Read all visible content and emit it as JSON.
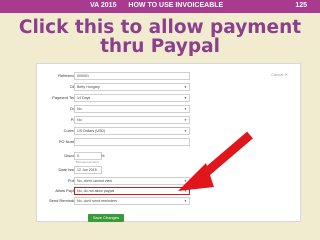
{
  "top_bar": {
    "course": "VA 2015",
    "topic": "HOW TO USE INVOICEABLE",
    "page": "125"
  },
  "headline": {
    "line1": "Click this to allow payment",
    "line2": "thru Paypal"
  },
  "form": {
    "cancel_label": "Cancel ✕",
    "reference": {
      "label": "Reference #:",
      "value": "000001"
    },
    "client": {
      "label": "Client:",
      "value": "Betty Hungary"
    },
    "payment_terms": {
      "label": "Payment Terms:",
      "value": "14 Days"
    },
    "draft": {
      "label": "Draft?",
      "value": "No"
    },
    "paid": {
      "label": "Paid?",
      "value": "No"
    },
    "currency": {
      "label": "Currency:",
      "value": "US Dollars (USD)"
    },
    "po_number": {
      "label": "PO Number:",
      "value": ""
    },
    "discount": {
      "label": "Discount:",
      "value": "0",
      "unit": "%"
    },
    "discount_hint": "Discount Amount",
    "date_issued": {
      "label": "Date Issued:",
      "value": "12 Jun 2015"
    },
    "public": {
      "label": "Public?",
      "value": "No, client cannot view"
    },
    "allow_paypal": {
      "label": "Allow PayPal?",
      "value": "No, do not allow paypal"
    },
    "send_reminders": {
      "label": "Send Reminders?",
      "value": "No, don't send reminders"
    },
    "save_label": "Save Changes"
  },
  "colors": {
    "top_bar": "#a83a8f",
    "headline": "#8b3f8d",
    "background": "#f1ebcf",
    "arrow": "#e0161c",
    "save_button": "#3a9a3a"
  }
}
